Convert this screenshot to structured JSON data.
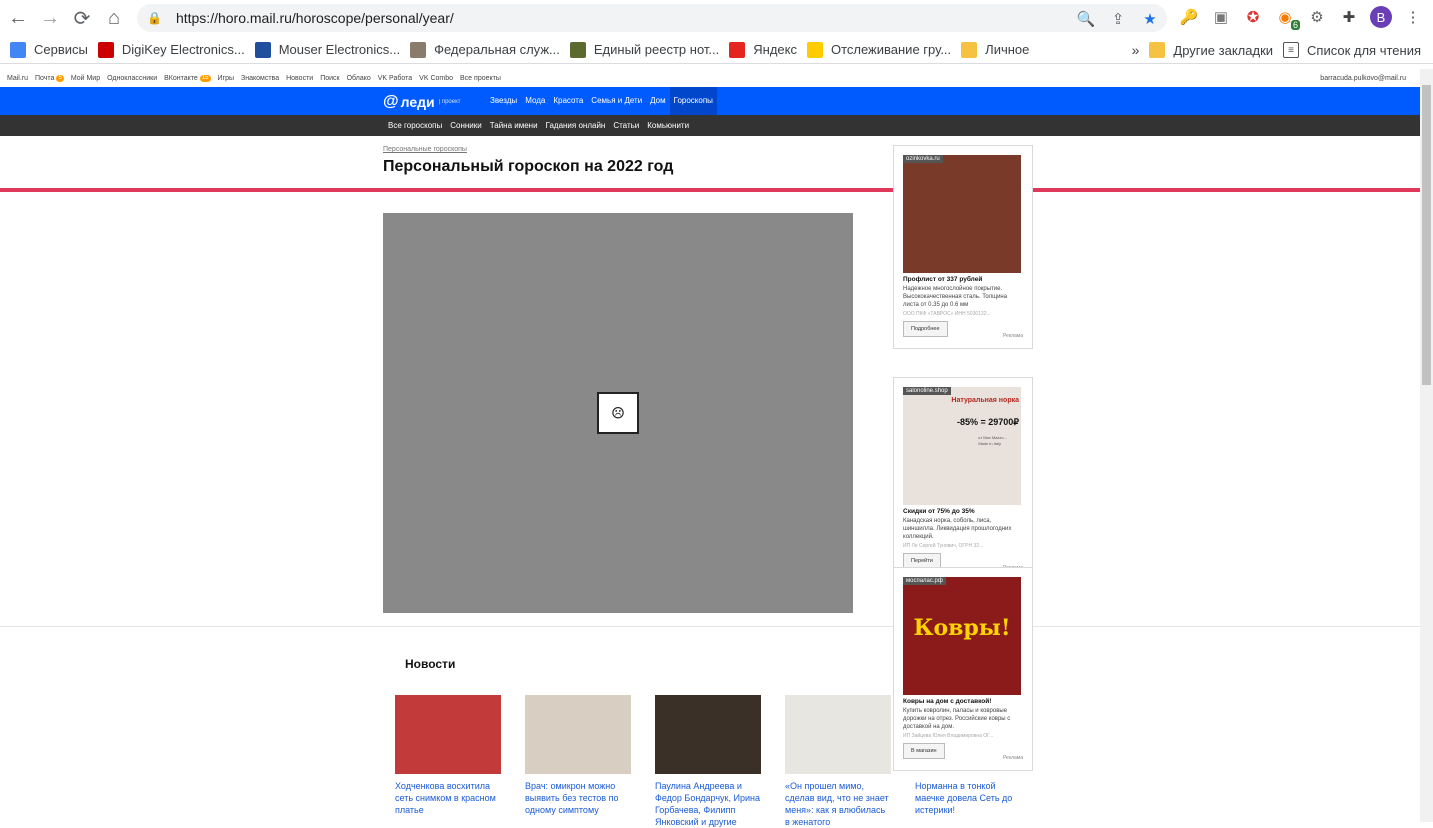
{
  "browser": {
    "url": "https://horo.mail.ru/horoscope/personal/year/",
    "profile_initial": "B",
    "extension_badge": "6",
    "bookmarks": [
      {
        "label": "Сервисы",
        "icon": "apps-grid-icon",
        "color": "#4285f4"
      },
      {
        "label": "DigiKey Electronics...",
        "icon": "digikey-icon",
        "color": "#cc0000"
      },
      {
        "label": "Mouser Electronics...",
        "icon": "mouser-icon",
        "color": "#1f4e9c"
      },
      {
        "label": "Федеральная служ...",
        "icon": "fns-icon",
        "color": "#8a7b6a"
      },
      {
        "label": "Единый реестр нот...",
        "icon": "notary-icon",
        "color": "#5b6b2f"
      },
      {
        "label": "Яндекс",
        "icon": "yandex-icon",
        "color": "#e52620"
      },
      {
        "label": "Отслеживание гру...",
        "icon": "dhl-icon",
        "color": "#ffcc00"
      },
      {
        "label": "Личное",
        "icon": "folder-icon",
        "color": "#f5c242"
      }
    ],
    "other_bookmarks": "Другие закладки",
    "reading_list": "Список для чтения"
  },
  "mailbar": {
    "items": [
      "Mail.ru",
      "Почта",
      "Мой Мир",
      "Одноклассники",
      "ВКонтакте",
      "Игры",
      "Знакомства",
      "Новости",
      "Поиск",
      "Облако",
      "VK Работа",
      "VK Combo",
      "Все проекты"
    ],
    "mail_count": "5",
    "vk_count": "15",
    "user": "barracuda.pulkovo@mail.ru"
  },
  "header": {
    "logo": "леди",
    "logo_sub": "| проект",
    "nav": [
      "Звезды",
      "Мода",
      "Красота",
      "Семья и Дети",
      "Дом",
      "Гороскопы"
    ],
    "subnav": [
      "Все гороскопы",
      "Сонники",
      "Тайна имени",
      "Гадания онлайн",
      "Статьи",
      "Комьюнити"
    ]
  },
  "page": {
    "breadcrumb": "Персональные гороскопы",
    "title": "Персональный гороскоп на 2022 год"
  },
  "news": {
    "heading": "Новости",
    "items": [
      {
        "caption": "Ходченкова восхитила сеть снимком в красном платье",
        "color": "#c23a3a"
      },
      {
        "caption": "Врач: омикрон можно выявить без тестов по одному симптому",
        "color": "#d8cfc2"
      },
      {
        "caption": "Паулина Андреева и Федор Бондарчук, Ирина Горбачева, Филипп Янковский и другие",
        "color": "#3a3028"
      },
      {
        "caption": "«Он прошел мимо, сделав вид, что не знает меня»: как я влюбилась в женатого",
        "color": "#e8e6e1"
      },
      {
        "caption": "Норманна в тонкой маечке довела Сеть до истерики!",
        "color": "#ffffff"
      }
    ]
  },
  "ads": [
    {
      "source": "ozinkovka.ru",
      "title": "Профлист от 337 рублей",
      "desc": "Надежное многослойное покрытие. Высококачественная сталь. Толщина листа от 0.35 до 0.6 мм",
      "legal": "ООО ПКФ «ТАВРОС» ИНН 5030132...",
      "button": "Подробнее",
      "label": "Реклама",
      "color": "#7a3a2a"
    },
    {
      "source": "salonoline.shop",
      "title": "Скидки от 75% до 35%",
      "desc": "Канадская норка, соболь, лиса, шиншилла. Ликвидация прошлогодних коллекций.",
      "legal": "ИП Ле Сергей Тунович, ОГРН 32...",
      "button": "Перейти",
      "label": "Реклама",
      "color": "#e9e2dc",
      "promo_top": "Натуральная норка",
      "promo_price": "-85% = 29700₽",
      "promo_small": "от Max Mazzo...",
      "promo_made": "Made in Italy"
    },
    {
      "source": "моспалас.рф",
      "title": "Ковры на дом с доставкой!",
      "desc": "Купить ковролин, паласы и ковровые дорожки на отрез. Российские ковры с доставкой на дом.",
      "legal": "ИП Зайцева Юлия Владимировна ОГ...",
      "button": "В магазин",
      "label": "Реклама",
      "color": "#8b1a1a",
      "promo": "Ковры!"
    }
  ]
}
